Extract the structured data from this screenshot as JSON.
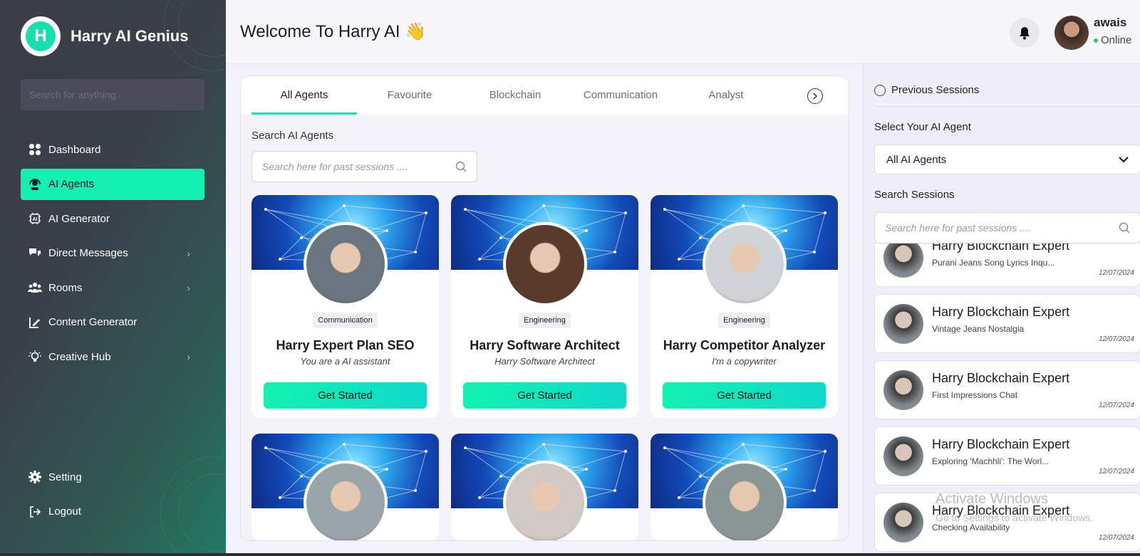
{
  "brand": {
    "logo_letter": "H",
    "name": "Harry AI Genius",
    "accent": "#13f0b2"
  },
  "sidebar": {
    "search_placeholder": "Search for anything...",
    "items": [
      {
        "label": "Dashboard",
        "icon": "dashboard-grid-icon"
      },
      {
        "label": "AI Agents",
        "icon": "agent-headset-icon",
        "active": true
      },
      {
        "label": "AI Generator",
        "icon": "ai-chip-icon"
      },
      {
        "label": "Direct Messages",
        "icon": "chat-bubbles-icon",
        "chevron": "›"
      },
      {
        "label": "Rooms",
        "icon": "people-icon",
        "chevron": "›"
      },
      {
        "label": "Content Generator",
        "icon": "content-pen-icon"
      },
      {
        "label": "Creative Hub",
        "icon": "lightbulb-icon",
        "chevron": "›"
      }
    ],
    "bottom": [
      {
        "label": "Setting",
        "icon": "gear-icon"
      },
      {
        "label": "Logout",
        "icon": "logout-icon"
      }
    ]
  },
  "header": {
    "welcome": "Welcome To Harry AI 👋",
    "user": {
      "name": "awais",
      "status": "Online"
    }
  },
  "main": {
    "tabs": [
      "All Agents",
      "Favourite",
      "Blockchain",
      "Communication",
      "Analyst"
    ],
    "active_tab": "All Agents",
    "search_label": "Search AI Agents",
    "search_placeholder": "Search here for past sessions ....",
    "agents": [
      {
        "category": "Communication",
        "name": "Harry Expert Plan SEO",
        "desc": "You are a AI assistant",
        "cta": "Get Started",
        "face": "#6b7580"
      },
      {
        "category": "Engineering",
        "name": "Harry Software Architect",
        "desc": "Harry Software Architect",
        "cta": "Get Started",
        "face": "#5a3a2a"
      },
      {
        "category": "Engineering",
        "name": "Harry Competitor Analyzer",
        "desc": "I'm a copywriter",
        "cta": "Get Started",
        "face": "#cfd2d6"
      },
      {
        "face": "#9aa5aa"
      },
      {
        "face": "#d0c9c4"
      },
      {
        "face": "#8a9596"
      }
    ]
  },
  "right": {
    "heading": "Previous Sessions",
    "select_label": "Select Your AI Agent",
    "select_value": "All AI Agents",
    "search_label": "Search Sessions",
    "search_placeholder": "Search here for past sessions ....",
    "sessions": [
      {
        "title": "Harry Blockchain Expert",
        "sub": "Purani Jeans Song Lyrics Inqu...",
        "date": "12/07/2024"
      },
      {
        "title": "Harry Blockchain Expert",
        "sub": "Vintage Jeans Nostalgia",
        "date": "12/07/2024"
      },
      {
        "title": "Harry Blockchain Expert",
        "sub": "First Impressions Chat",
        "date": "12/07/2024"
      },
      {
        "title": "Harry Blockchain Expert",
        "sub": "Exploring 'Machhli': The Worl...",
        "date": "12/07/2024"
      },
      {
        "title": "Harry Blockchain Expert",
        "sub": "Checking Availability",
        "date": "12/07/2024"
      }
    ]
  },
  "watermark": {
    "line1": "Activate Windows",
    "line2": "Go to Settings to activate Windows."
  }
}
